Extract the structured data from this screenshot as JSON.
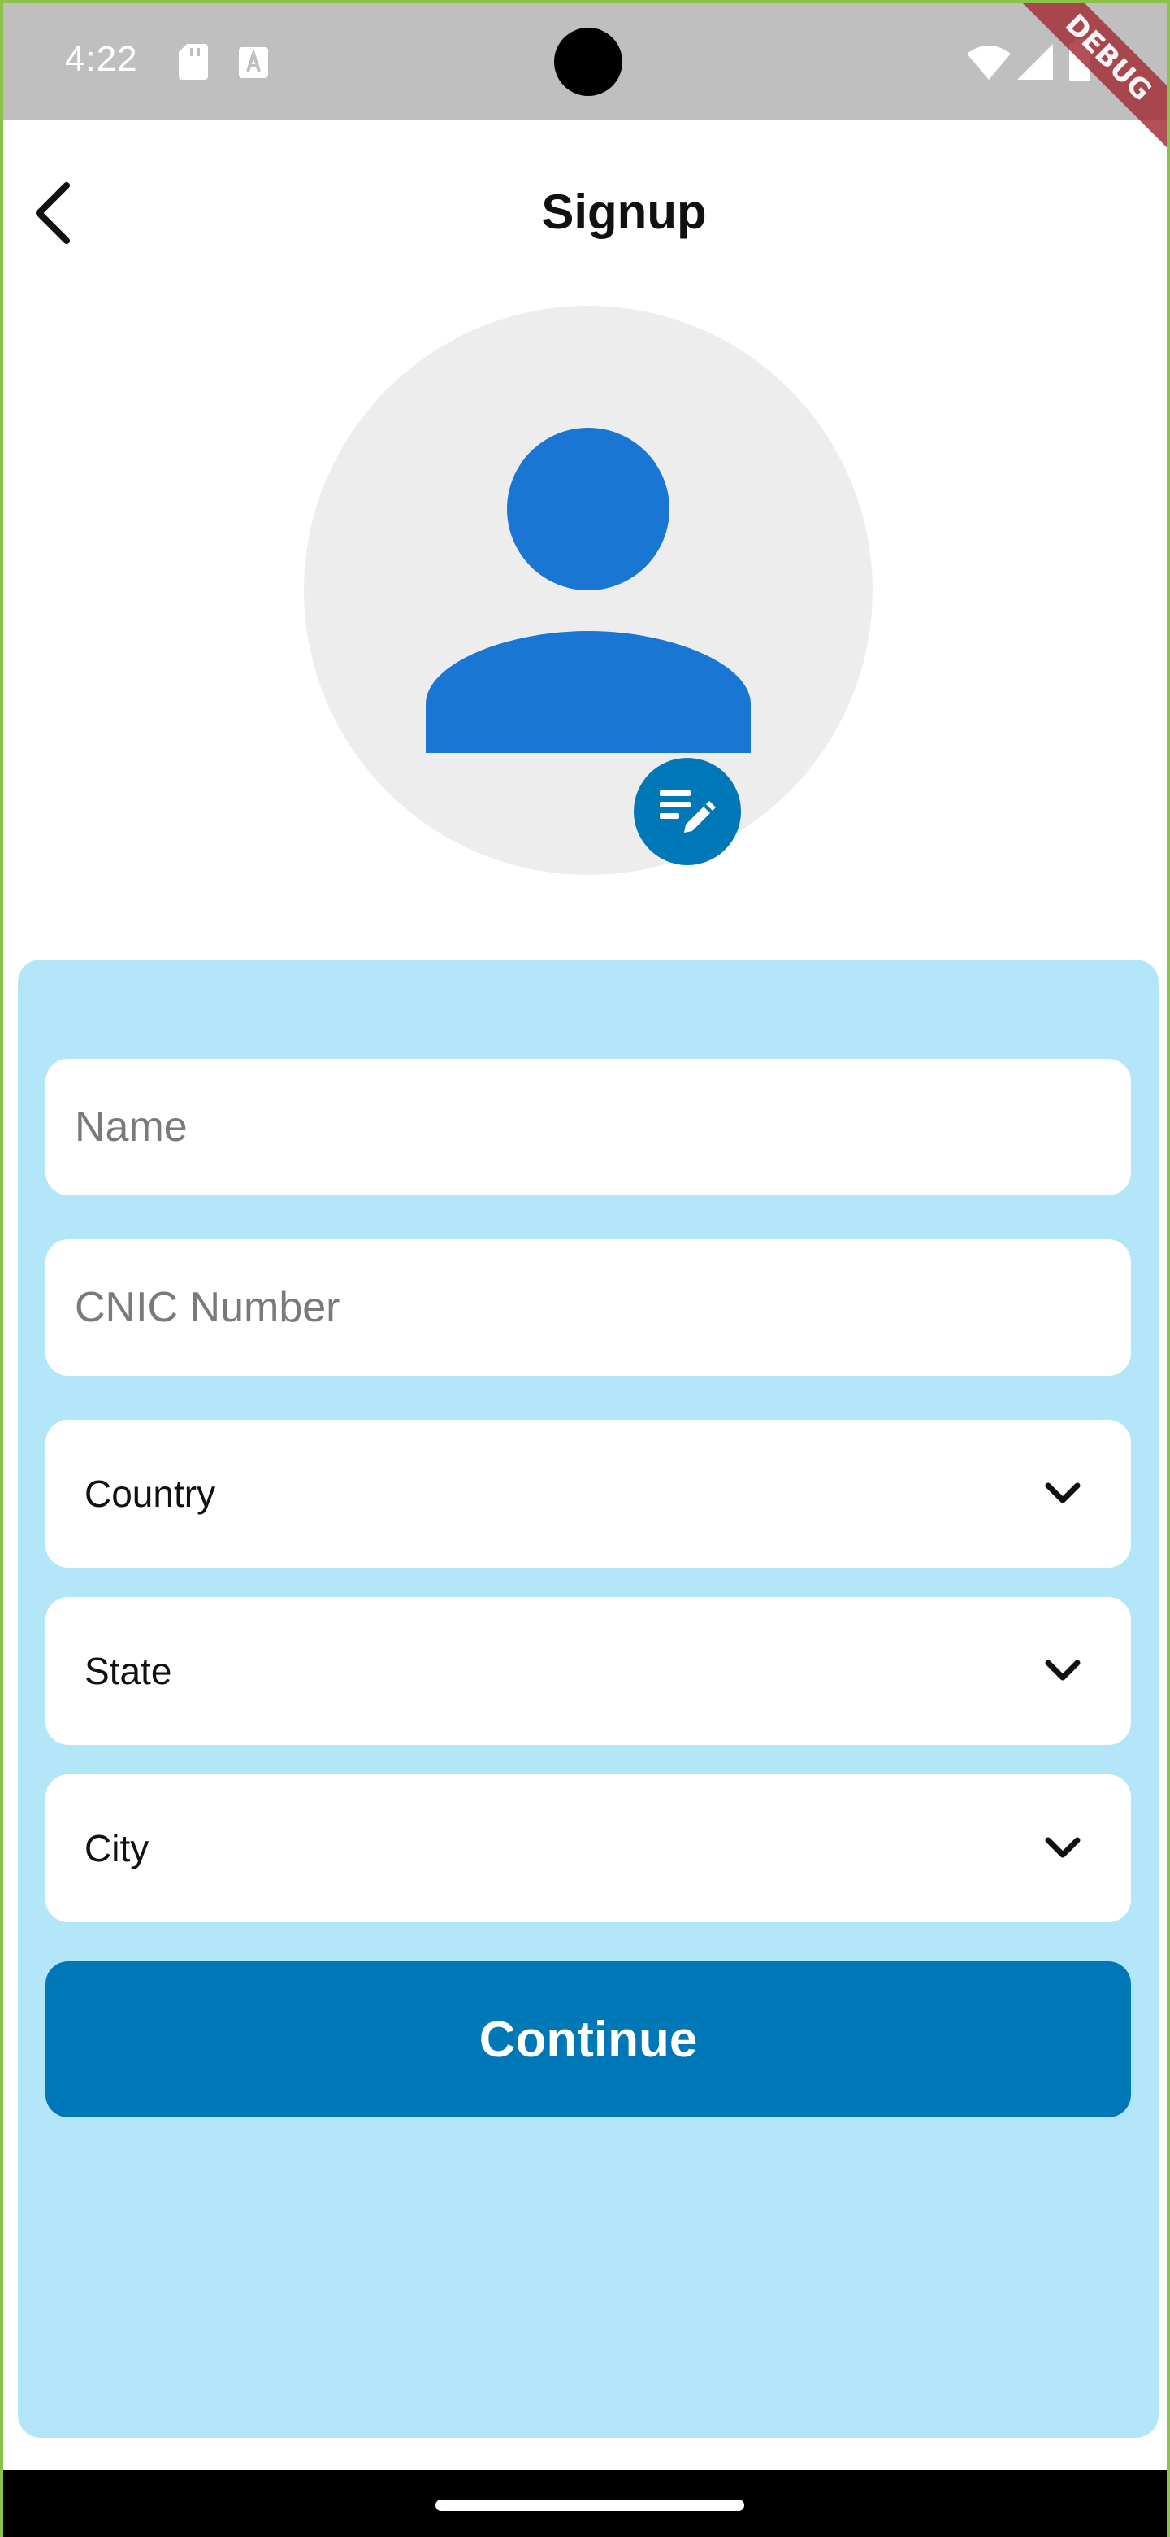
{
  "status_bar": {
    "time": "4:22",
    "left_icons": [
      "sd-card-icon",
      "keyboard-icon"
    ],
    "right_icons": [
      "wifi-icon",
      "cellular-icon",
      "battery-icon"
    ],
    "debug_label": "DEBUG"
  },
  "app_bar": {
    "back_icon": "back-arrow-icon",
    "title": "Signup"
  },
  "avatar": {
    "icon": "person-icon",
    "edit_icon": "edit-note-icon"
  },
  "form": {
    "name": {
      "placeholder": "Name",
      "value": ""
    },
    "cnic": {
      "placeholder": "CNIC Number",
      "value": ""
    },
    "country": {
      "label": "Country"
    },
    "state": {
      "label": "State"
    },
    "city": {
      "label": "City"
    },
    "continue_label": "Continue"
  },
  "colors": {
    "primary": "#0077b6",
    "panel": "#b3e6f8",
    "avatar_bg": "#ededed",
    "person": "#1976d2",
    "status_bar": "#bfbfbf"
  }
}
